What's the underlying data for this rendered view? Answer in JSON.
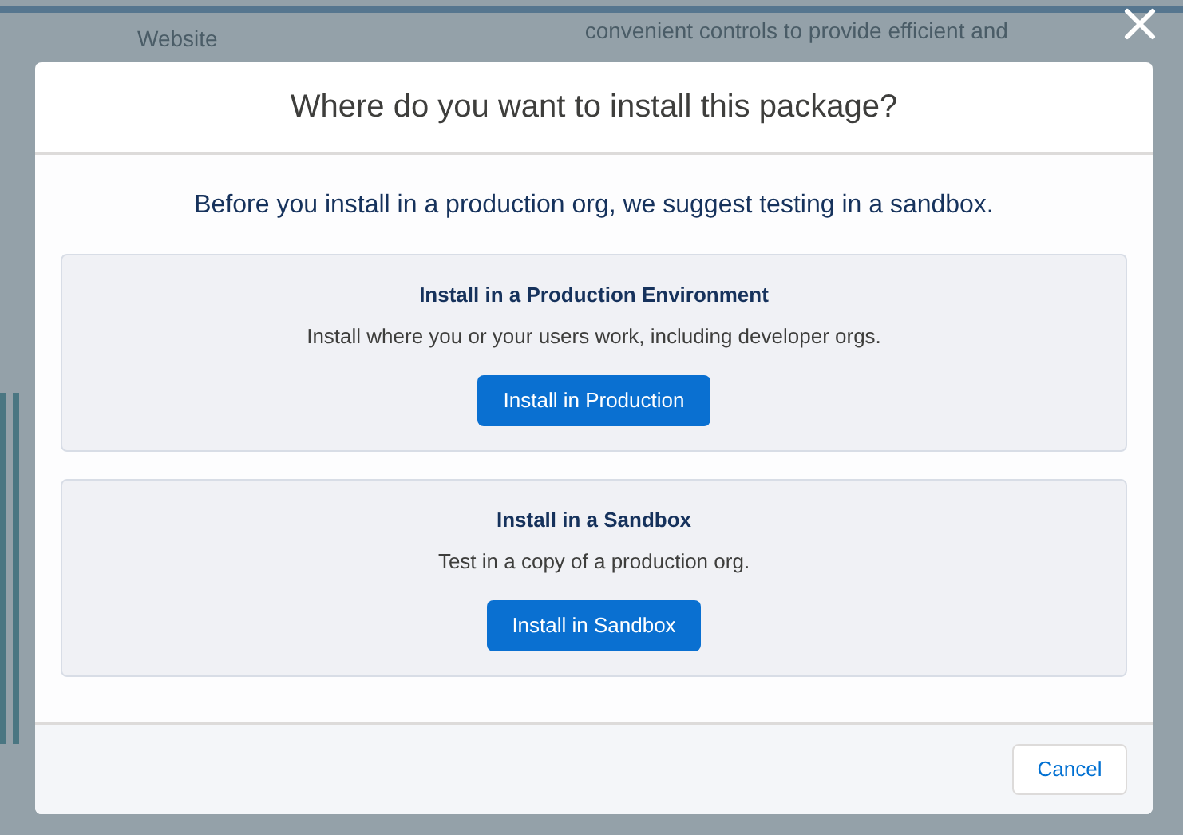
{
  "background_page": {
    "label": "Website",
    "text": "convenient controls to provide efficient and"
  },
  "dialog": {
    "title": "Where do you want to install this package?",
    "intro": "Before you install in a production org, we suggest testing in a sandbox.",
    "options": [
      {
        "heading": "Install in a Production Environment",
        "description": "Install where you or your users work, including developer orgs.",
        "button": "Install in Production"
      },
      {
        "heading": "Install in a Sandbox",
        "description": "Test in a copy of a production org.",
        "button": "Install in Sandbox"
      }
    ],
    "cancel": "Cancel"
  }
}
